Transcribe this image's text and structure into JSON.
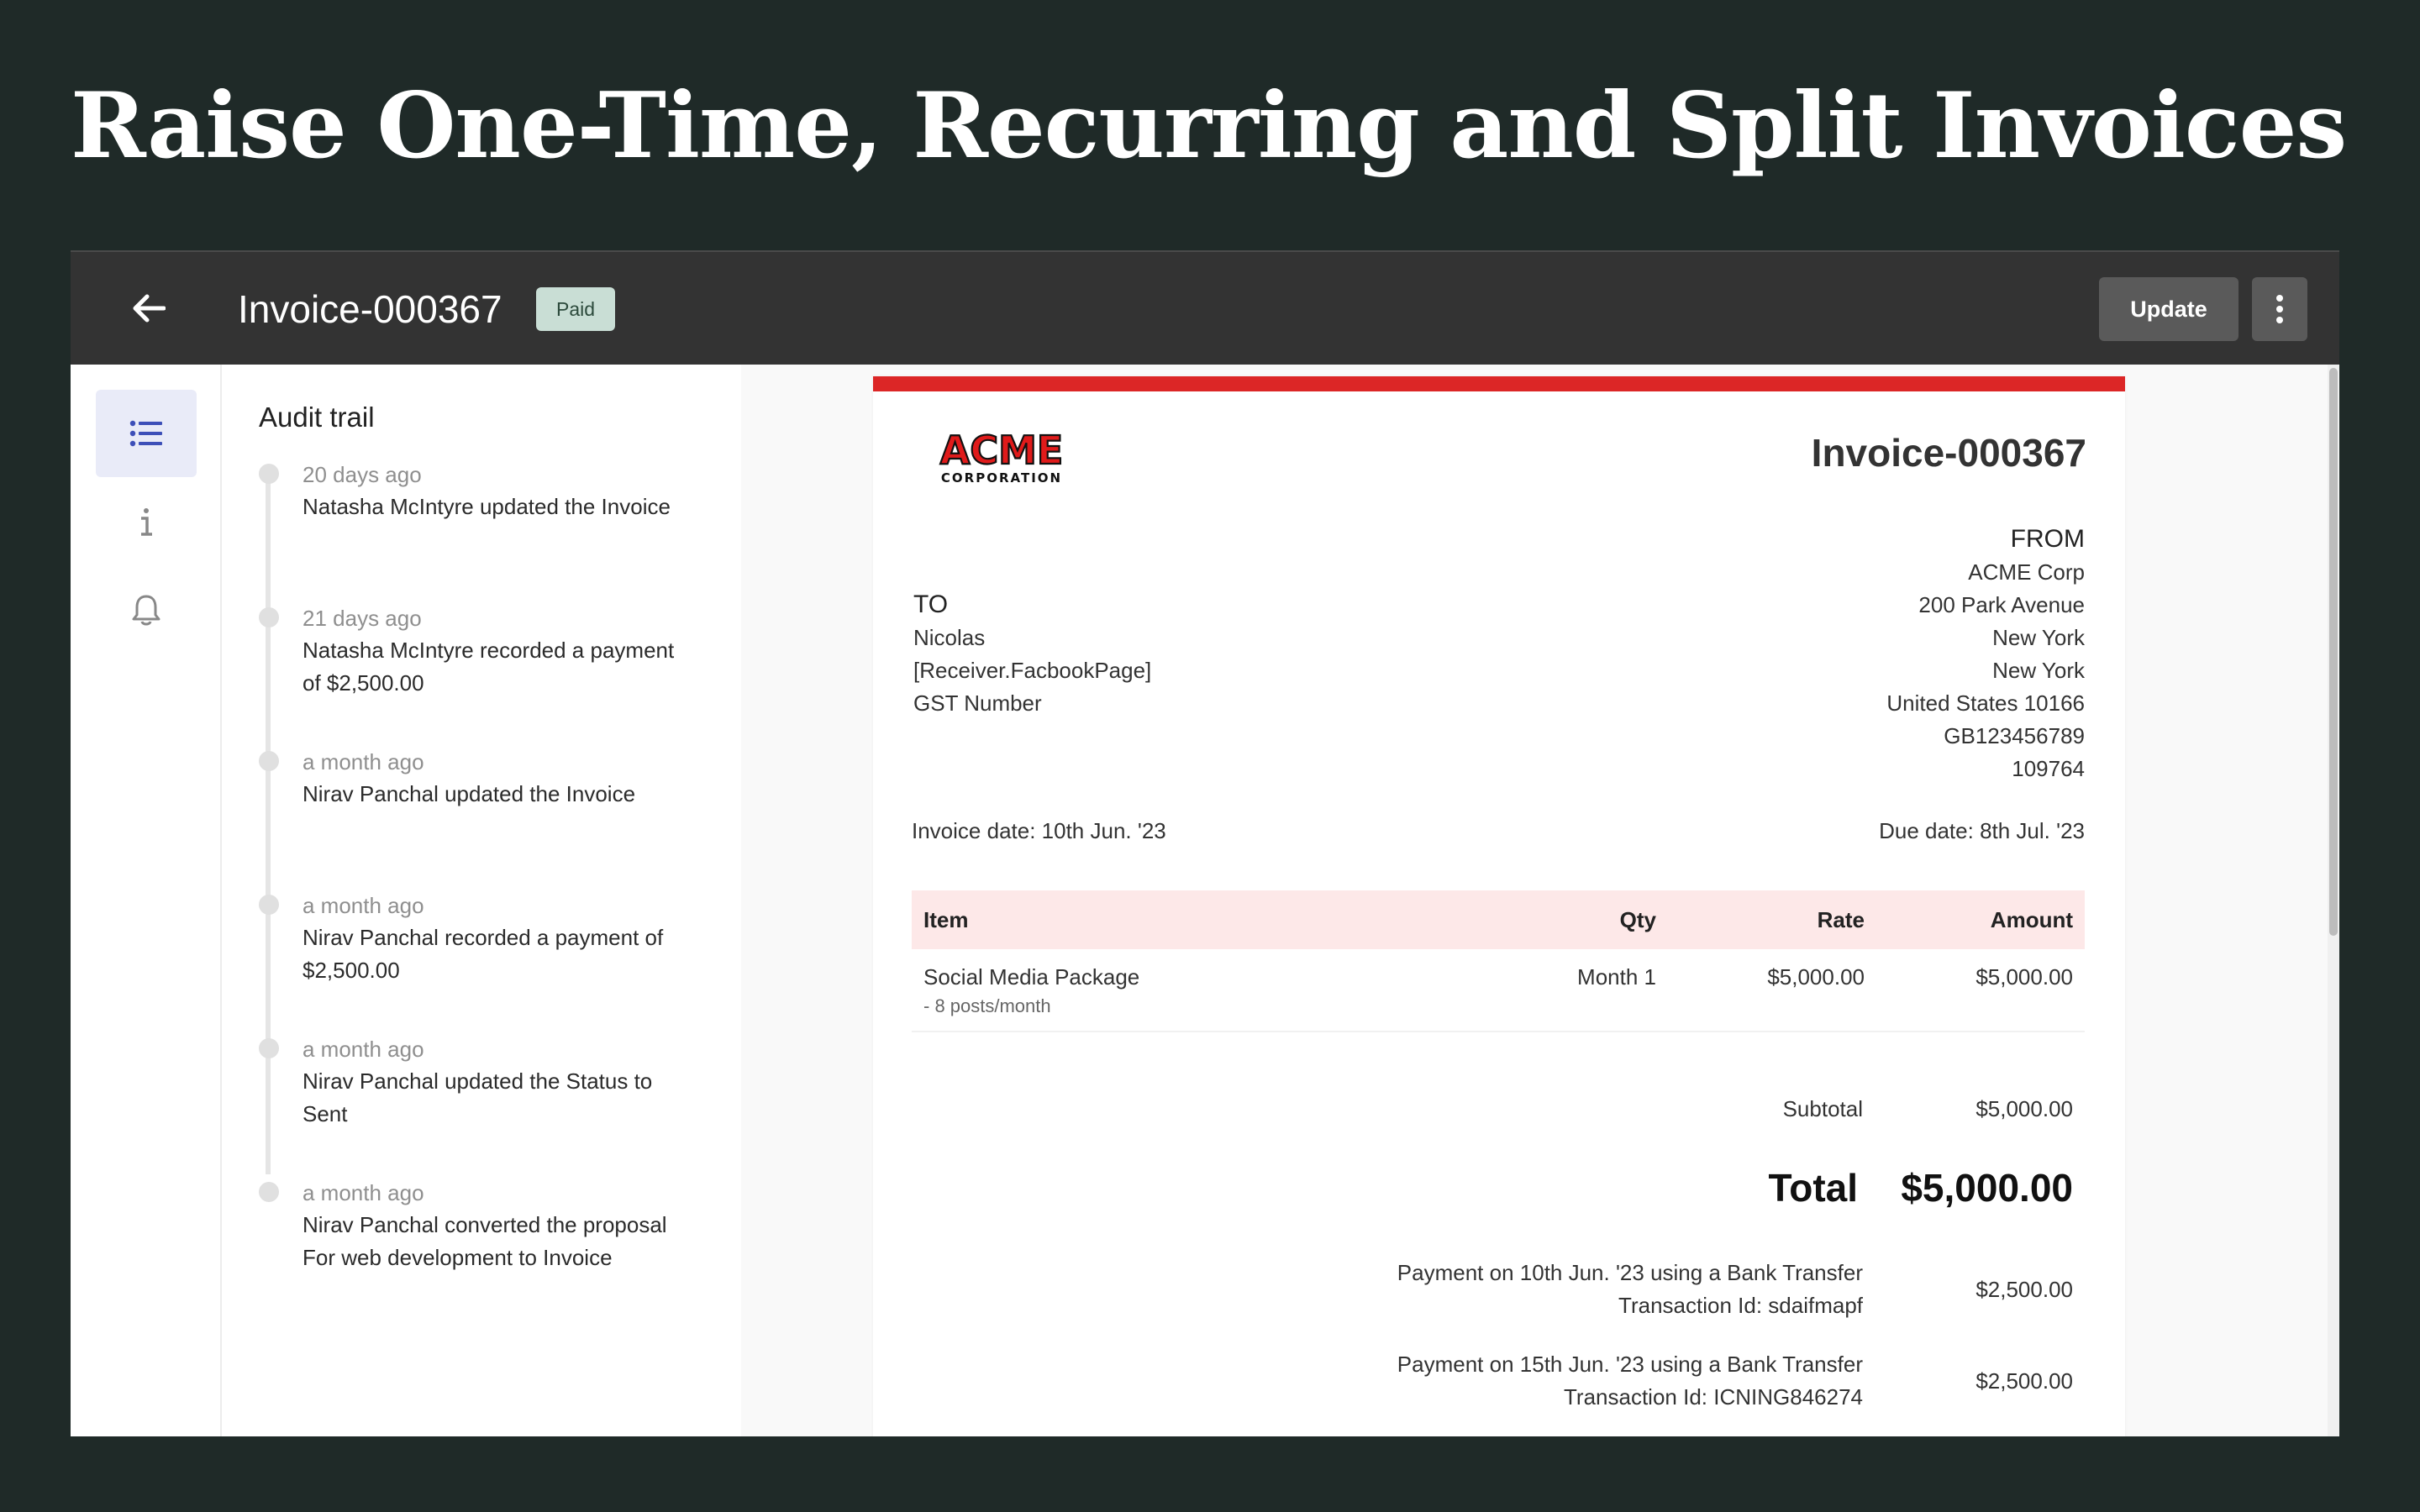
{
  "headline": "Raise One-Time, Recurring and Split Invoices",
  "topbar": {
    "title": "Invoice-000367",
    "status": "Paid",
    "update_label": "Update"
  },
  "rail": {
    "items": [
      {
        "icon": "list-icon",
        "active": true
      },
      {
        "icon": "info-icon",
        "active": false
      },
      {
        "icon": "bell-icon",
        "active": false
      }
    ]
  },
  "audit": {
    "title": "Audit trail",
    "entries": [
      {
        "time": "20 days ago",
        "text": "Natasha McIntyre updated the Invoice"
      },
      {
        "time": "21 days ago",
        "text": "Natasha McIntyre recorded a payment of $2,500.00"
      },
      {
        "time": "a month ago",
        "text": "Nirav Panchal updated the Invoice"
      },
      {
        "time": "a month ago",
        "text": "Nirav Panchal recorded a payment of $2,500.00"
      },
      {
        "time": "a month ago",
        "text": "Nirav Panchal updated the Status to Sent"
      },
      {
        "time": "a month ago",
        "text": "Nirav Panchal converted the proposal For web development to Invoice"
      }
    ]
  },
  "invoice": {
    "accent_color": "#dc2626",
    "logo": {
      "line1": "ACME",
      "line2": "CORPORATION"
    },
    "number": "Invoice-000367",
    "from": {
      "label": "FROM",
      "lines": [
        "ACME Corp",
        "200 Park Avenue",
        "New York",
        "New York",
        "United States 10166",
        "GB123456789",
        "109764"
      ]
    },
    "to": {
      "label": "TO",
      "lines": [
        "Nicolas",
        "[Receiver.FacbookPage]",
        "GST Number"
      ]
    },
    "invoice_date": "Invoice date: 10th Jun. '23",
    "due_date": "Due date: 8th Jul. '23",
    "table": {
      "headers": {
        "item": "Item",
        "qty": "Qty",
        "rate": "Rate",
        "amount": "Amount"
      },
      "rows": [
        {
          "item": "Social Media Package",
          "sub": "- 8 posts/month",
          "qty": "Month 1",
          "rate": "$5,000.00",
          "amount": "$5,000.00"
        }
      ]
    },
    "subtotal_label": "Subtotal",
    "subtotal_value": "$5,000.00",
    "total_label": "Total",
    "total_value": "$5,000.00",
    "payments": [
      {
        "line1": "Payment on 10th Jun. '23 using a Bank Transfer",
        "line2": "Transaction Id: sdaifmapf",
        "amount": "$2,500.00"
      },
      {
        "line1": "Payment on 15th Jun. '23 using a Bank Transfer",
        "line2": "Transaction Id: ICNING846274",
        "amount": "$2,500.00"
      }
    ]
  }
}
